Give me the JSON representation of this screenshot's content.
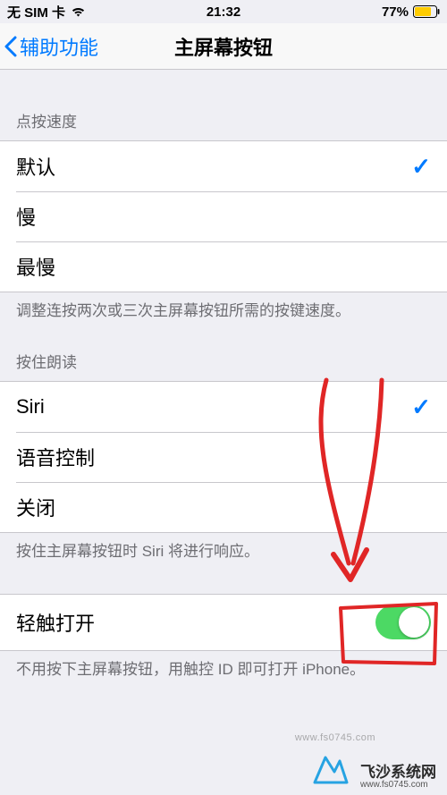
{
  "status": {
    "carrier": "无 SIM 卡",
    "time": "21:32",
    "battery": "77%"
  },
  "nav": {
    "back": "辅助功能",
    "title": "主屏幕按钮"
  },
  "sections": {
    "click_speed": {
      "header": "点按速度",
      "options": [
        {
          "label": "默认",
          "selected": true
        },
        {
          "label": "慢",
          "selected": false
        },
        {
          "label": "最慢",
          "selected": false
        }
      ],
      "footer": "调整连按两次或三次主屏幕按钮所需的按键速度。"
    },
    "press_hold": {
      "header": "按住朗读",
      "options": [
        {
          "label": "Siri",
          "selected": true
        },
        {
          "label": "语音控制",
          "selected": false
        },
        {
          "label": "关闭",
          "selected": false
        }
      ],
      "footer": "按住主屏幕按钮时 Siri 将进行响应。"
    },
    "rest_finger": {
      "label": "轻触打开",
      "on": true,
      "footer": "不用按下主屏幕按钮，用触控 ID 即可打开 iPhone。"
    }
  },
  "watermark": {
    "brand": "飞沙系统网",
    "url": "www.fs0745.com"
  },
  "annotation": {
    "color": "#e02626"
  }
}
